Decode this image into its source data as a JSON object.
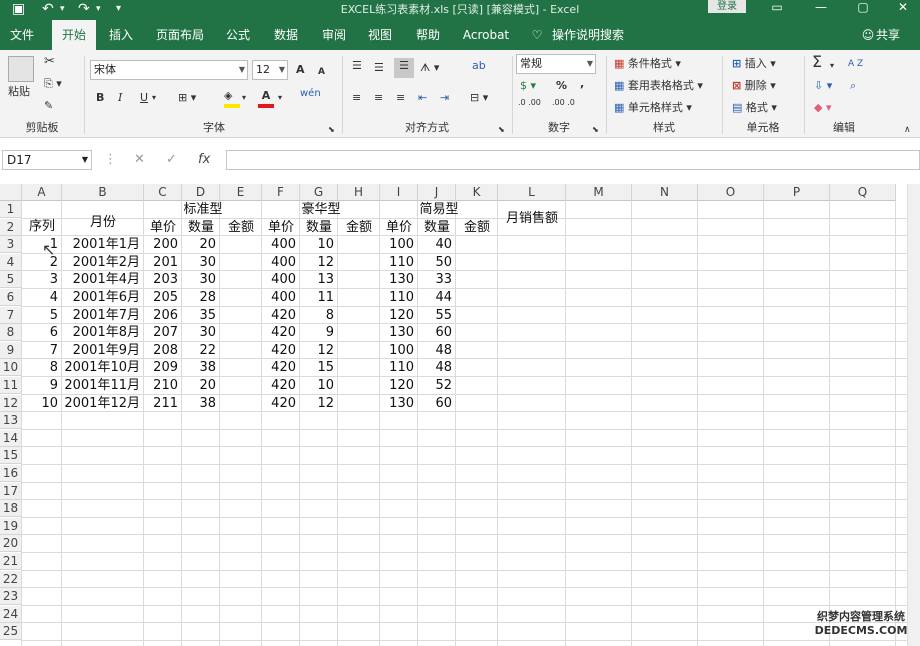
{
  "titlebar": {
    "title": "EXCEL练习表素材.xls [只读] [兼容模式] - Excel",
    "login": "登录",
    "save_icon": "save-icon",
    "undo": "↶",
    "redo": "↷",
    "more": "▾"
  },
  "tabs": [
    "文件",
    "开始",
    "插入",
    "页面布局",
    "公式",
    "数据",
    "审阅",
    "视图",
    "帮助",
    "Acrobat"
  ],
  "tell_me": "操作说明搜索",
  "share": "共享",
  "ribbon": {
    "clipboard": {
      "label": "剪贴板",
      "paste": "粘贴"
    },
    "font": {
      "label": "字体",
      "name": "宋体",
      "size": "12",
      "grow": "A",
      "shrink": "A",
      "bold": "B",
      "italic": "I",
      "underline": "U",
      "phonetic": "wén"
    },
    "alignment": {
      "label": "对齐方式"
    },
    "number": {
      "label": "数字",
      "format": "常规",
      "percent": "%",
      "comma": ",",
      "inc": ".0 .00",
      "dec": ".00 .0"
    },
    "styles": {
      "label": "样式",
      "cond": "条件格式",
      "table": "套用表格格式",
      "cell": "单元格样式"
    },
    "cells": {
      "label": "单元格",
      "insert": "插入",
      "delete": "删除",
      "format": "格式"
    },
    "editing": {
      "label": "编辑",
      "sum": "Σ",
      "sort": "A Z",
      "find": "⌕"
    }
  },
  "namebox": "D17",
  "fx": "fx",
  "columns": [
    "A",
    "B",
    "C",
    "D",
    "E",
    "F",
    "G",
    "H",
    "I",
    "J",
    "K",
    "L",
    "M",
    "N",
    "O",
    "P",
    "Q"
  ],
  "rows": [
    "1",
    "2",
    "3",
    "4",
    "5",
    "6",
    "7",
    "8",
    "9",
    "10",
    "11",
    "12",
    "13",
    "14",
    "15",
    "16",
    "17",
    "18",
    "19",
    "20",
    "21",
    "22",
    "23",
    "24",
    "25"
  ],
  "headers": {
    "seq": "序列",
    "month": "月份",
    "std": "标准型",
    "lux": "豪华型",
    "simple": "简易型",
    "total": "月销售额",
    "price": "单价",
    "qty": "数量",
    "amount": "金额"
  },
  "data": [
    [
      "1",
      "2001年1月",
      "200",
      "20",
      "400",
      "10",
      "100",
      "40"
    ],
    [
      "2",
      "2001年2月",
      "201",
      "30",
      "400",
      "12",
      "110",
      "50"
    ],
    [
      "3",
      "2001年4月",
      "203",
      "30",
      "400",
      "13",
      "130",
      "33"
    ],
    [
      "4",
      "2001年6月",
      "205",
      "28",
      "400",
      "11",
      "110",
      "44"
    ],
    [
      "5",
      "2001年7月",
      "206",
      "35",
      "420",
      "8",
      "120",
      "55"
    ],
    [
      "6",
      "2001年8月",
      "207",
      "30",
      "420",
      "9",
      "130",
      "60"
    ],
    [
      "7",
      "2001年9月",
      "208",
      "22",
      "420",
      "12",
      "100",
      "48"
    ],
    [
      "8",
      "2001年10月",
      "209",
      "38",
      "420",
      "15",
      "110",
      "48"
    ],
    [
      "9",
      "2001年11月",
      "210",
      "20",
      "420",
      "10",
      "120",
      "52"
    ],
    [
      "10",
      "2001年12月",
      "211",
      "38",
      "420",
      "12",
      "130",
      "60"
    ]
  ],
  "watermark": {
    "line1": "织梦内容管理系统",
    "line2": "DEDECMS.COM"
  }
}
